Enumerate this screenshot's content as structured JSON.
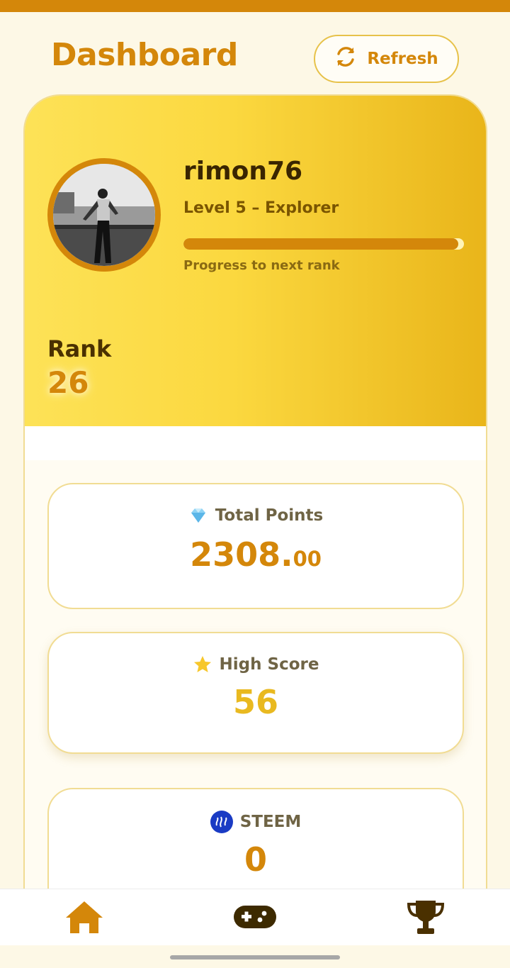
{
  "header": {
    "title": "Dashboard",
    "refresh_label": "Refresh"
  },
  "profile": {
    "username": "rimon76",
    "level": "Level 5 – Explorer",
    "progress_label": "Progress to next rank",
    "progress_fraction": 0.98,
    "rank_label": "Rank",
    "rank_value": "26"
  },
  "stats": {
    "total_points": {
      "label": "Total Points",
      "value_int": "2308.",
      "value_dec": "00",
      "icon": "gem-icon"
    },
    "high_score": {
      "label": "High Score",
      "value": "56",
      "icon": "star-icon"
    },
    "steem": {
      "label": "STEEM",
      "value": "0",
      "icon": "steem-logo-icon"
    }
  },
  "nav": {
    "items": [
      "home-icon",
      "gamepad-icon",
      "trophy-icon"
    ]
  },
  "colors": {
    "accent": "#d4870a",
    "gold": "#fbd83f",
    "background": "#fdf8e6"
  }
}
